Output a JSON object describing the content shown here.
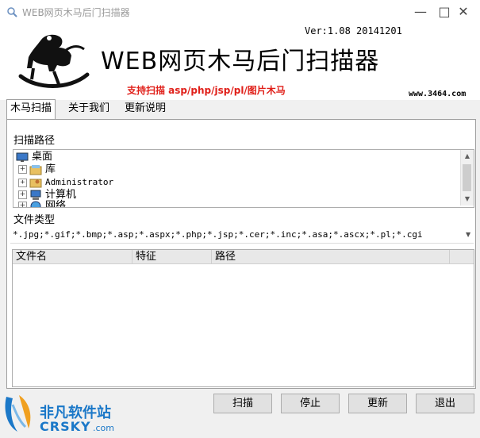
{
  "window": {
    "title": "WEB网页木马后门扫描器",
    "minimize": "—",
    "maximize": "□",
    "close": "✕"
  },
  "header": {
    "version": "Ver:1.08 20141201",
    "app_title": "WEB网页木马后门扫描器",
    "subtitle": "支持扫描 asp/php/jsp/pl/图片木马",
    "url": "www.3464.com"
  },
  "tabs": [
    {
      "label": "木马扫描",
      "active": true
    },
    {
      "label": "关于我们",
      "active": false
    },
    {
      "label": "更新说明",
      "active": false
    }
  ],
  "scan_path": {
    "label": "扫描路径",
    "items": [
      {
        "label": "桌面",
        "icon": "desktop-icon",
        "expandable": false
      },
      {
        "label": "库",
        "icon": "library-icon",
        "expandable": true
      },
      {
        "label": "Administrator",
        "icon": "user-folder-icon",
        "expandable": true
      },
      {
        "label": "计算机",
        "icon": "computer-icon",
        "expandable": true
      },
      {
        "label": "网络",
        "icon": "network-icon",
        "expandable": true
      }
    ]
  },
  "file_type": {
    "label": "文件类型",
    "value": "*.jpg;*.gif;*.bmp;*.asp;*.aspx;*.php;*.jsp;*.cer;*.inc;*.asa;*.ascx;*.pl;*.cgi"
  },
  "results": {
    "columns": [
      "文件名",
      "特征",
      "路径"
    ],
    "rows": []
  },
  "buttons": {
    "scan": "扫描",
    "stop": "停止",
    "update": "更新",
    "exit": "退出"
  },
  "watermark": {
    "cn": "非凡软件站",
    "en": "CRSKY",
    "dotcom": ".com"
  },
  "colors": {
    "subtitle": "#e0201a",
    "watermark_blue": "#1b78c8"
  }
}
